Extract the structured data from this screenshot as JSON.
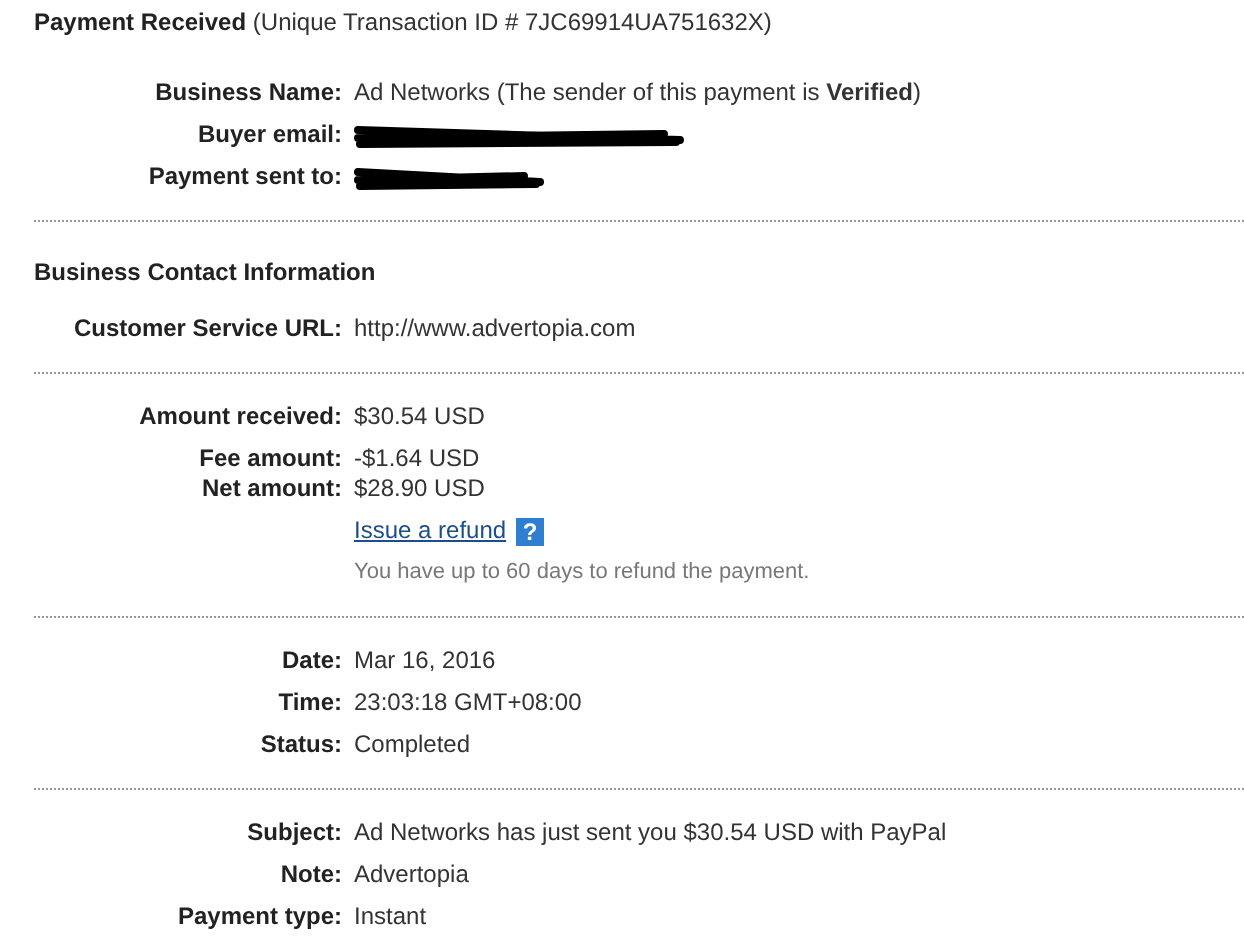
{
  "header": {
    "title": "Payment Received",
    "detail": "(Unique Transaction ID # 7JC69914UA751632X)"
  },
  "sections": [
    {
      "groups": [
        [
          {
            "kind": "text",
            "label": "Business Name:",
            "value": "Ad Networks (The sender of this payment is **Verified**)"
          }
        ],
        [
          {
            "kind": "redacted",
            "label": "Buyer email:"
          }
        ],
        [
          {
            "kind": "redacted",
            "label": "Payment sent to:"
          }
        ]
      ]
    },
    {
      "heading": "Business Contact Information",
      "groups": [
        [
          {
            "kind": "text",
            "label": "Customer Service URL:",
            "value": "http://www.advertopia.com"
          }
        ]
      ]
    },
    {
      "groups": [
        [
          {
            "kind": "text",
            "label": "Amount received:",
            "value": "$30.54 USD"
          }
        ],
        [
          {
            "kind": "text",
            "label": "Fee amount:",
            "value": "-$1.64 USD"
          },
          {
            "kind": "text",
            "label": "Net amount:",
            "value": "$28.90 USD"
          }
        ],
        [
          {
            "kind": "link",
            "value": "Issue a refund",
            "icon": "?"
          }
        ],
        [
          {
            "kind": "note",
            "value": "You have up to 60 days to refund the payment."
          }
        ]
      ]
    },
    {
      "groups": [
        [
          {
            "kind": "text",
            "label": "Date:",
            "value": "Mar 16, 2016"
          }
        ],
        [
          {
            "kind": "text",
            "label": "Time:",
            "value": "23:03:18 GMT+08:00"
          }
        ],
        [
          {
            "kind": "text",
            "label": "Status:",
            "value": "Completed"
          }
        ]
      ]
    },
    {
      "groups": [
        [
          {
            "kind": "text",
            "label": "Subject:",
            "value": "Ad Networks has just sent you $30.54 USD with PayPal"
          }
        ],
        [
          {
            "kind": "text",
            "label": "Note:",
            "value": "Advertopia"
          }
        ],
        [
          {
            "kind": "text",
            "label": "Payment type:",
            "value": "Instant"
          }
        ]
      ]
    }
  ]
}
